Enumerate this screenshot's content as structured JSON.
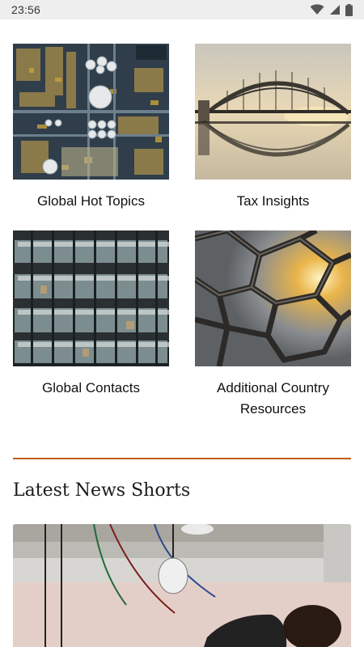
{
  "status_bar": {
    "time": "23:56",
    "icons": [
      "wifi-icon",
      "signal-icon",
      "battery-icon"
    ]
  },
  "tiles": [
    {
      "label": "Global Hot Topics",
      "image": "industrial-plant-aerial"
    },
    {
      "label": "Tax Insights",
      "image": "harbour-bridge"
    },
    {
      "label": "Global Contacts",
      "image": "office-building-windows"
    },
    {
      "label": "Additional Country Resources",
      "image": "steel-lattice-architecture"
    }
  ],
  "news": {
    "section_title": "Latest News Shorts",
    "lead_image": "vr-headset-workspace"
  },
  "colors": {
    "divider": "#c25b1d",
    "status_bar_bg": "#eeeeee"
  }
}
